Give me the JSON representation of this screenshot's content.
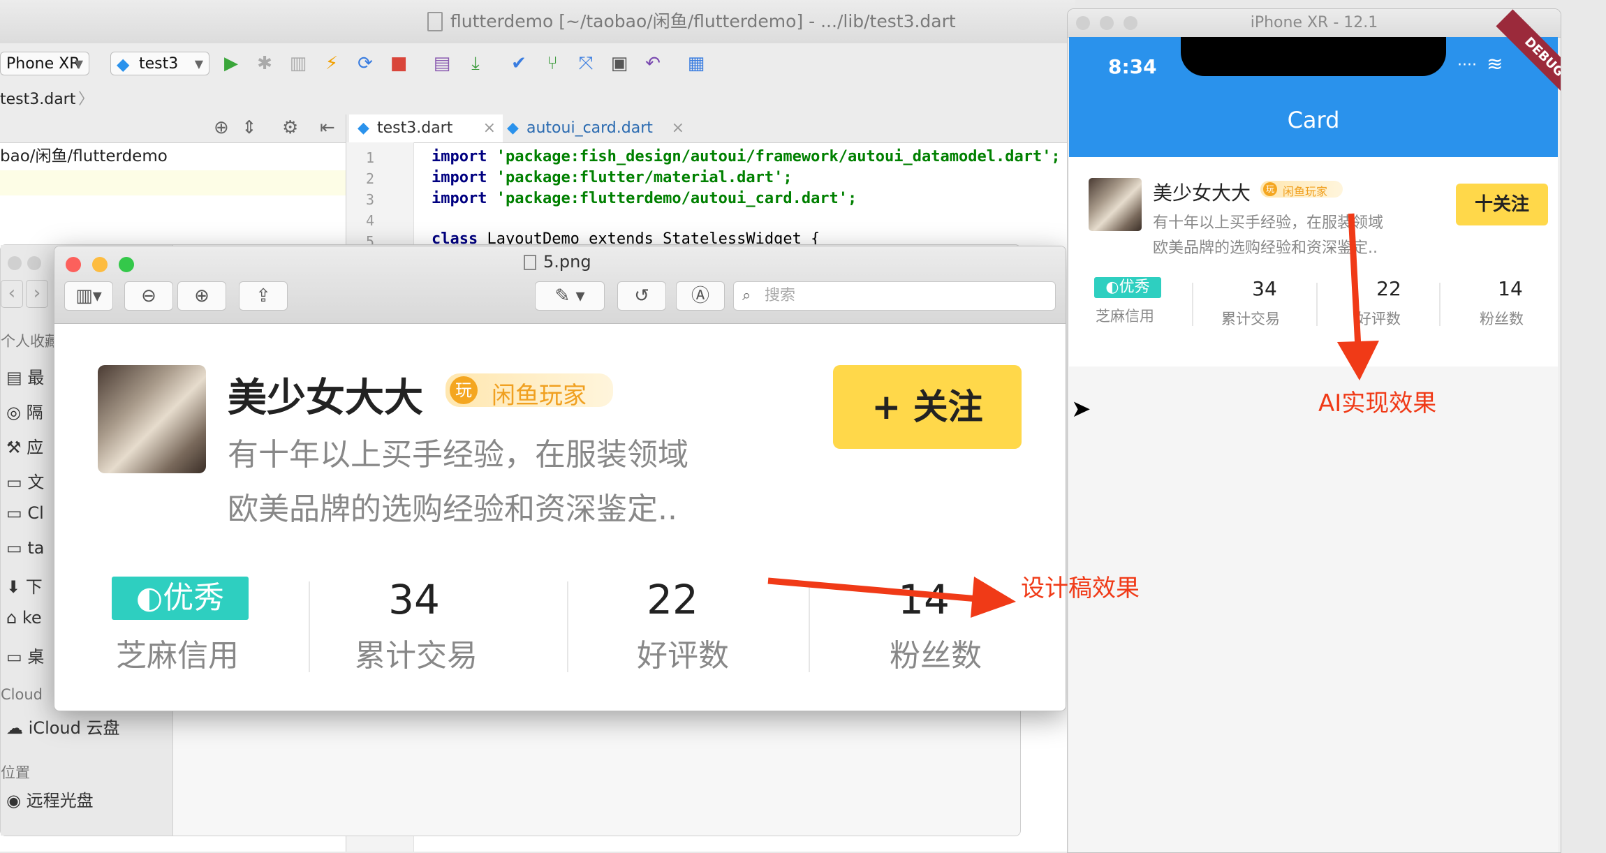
{
  "ide": {
    "window_title": "flutterdemo [~/taobao/闲鱼/flutterdemo] - .../lib/test3.dart [flutterdemo]",
    "device_select": "Phone XR",
    "config_select": "test3",
    "breadcrumb": "test3.dart",
    "project_path": "bao/闲鱼/flutterdemo",
    "tabs": [
      {
        "label": "test3.dart"
      },
      {
        "label": "autoui_card.dart"
      }
    ],
    "code_lines": [
      {
        "num": "1",
        "kw": "import",
        "rest": " 'package:fish_design/autoui/framework/autoui_datamodel.dart';"
      },
      {
        "num": "2",
        "kw": "import",
        "rest": " 'package:flutter/material.dart';"
      },
      {
        "num": "3",
        "kw": "import",
        "rest": " 'package:flutterdemo/autoui_card.dart';"
      },
      {
        "num": "4",
        "kw": "",
        "rest": ""
      },
      {
        "num": "5",
        "kw": "class",
        "rest": " LayoutDemo extends StatelessWidget {"
      }
    ]
  },
  "finder": {
    "sidebar_items": [
      "个人收藏",
      "最",
      "隔",
      "应",
      "文",
      "Cl",
      "ta",
      "下",
      "ke",
      "桌"
    ],
    "cloud_heading": "Cloud",
    "icloud_item": "iCloud 云盘",
    "location_heading": "位置",
    "remote_disc": "远程光盘"
  },
  "preview": {
    "title": "5.png",
    "search_placeholder": "搜索",
    "card": {
      "name": "美少女大大",
      "badge": "闲鱼玩家",
      "badge_icon": "玩",
      "description_line1": "有十年以上买手经验，在服装领域",
      "description_line2": "欧美品牌的选购经验和资深鉴定..",
      "follow_label": "+ 关注",
      "credit_badge": "优秀",
      "credit_label": "芝麻信用",
      "stats": [
        {
          "value": "34",
          "label": "累计交易"
        },
        {
          "value": "22",
          "label": "好评数"
        },
        {
          "value": "14",
          "label": "粉丝数"
        }
      ]
    }
  },
  "simulator": {
    "window_title": "iPhone XR - 12.1",
    "time": "8:34",
    "debug_ribbon": "DEBUG",
    "appbar_title": "Card",
    "card": {
      "name": "美少女大大",
      "badge": "闲鱼玩家",
      "badge_icon": "玩",
      "description_line1": "有十年以上买手经验，在服装领域",
      "description_line2": "欧美品牌的选购经验和资深鉴定..",
      "follow_label": "十关注",
      "credit_badge": "优秀",
      "credit_label": "芝麻信用",
      "stats": [
        {
          "value": "34",
          "label": "累计交易"
        },
        {
          "value": "22",
          "label": "好评数"
        },
        {
          "value": "14",
          "label": "粉丝数"
        }
      ]
    }
  },
  "annotations": {
    "ai_label": "AI实现效果",
    "design_label": "设计稿效果",
    "color": "#f03a17"
  },
  "colors": {
    "appbar": "#2a92ec",
    "follow_button": "#ffd84a",
    "credit_badge": "#2ecfc0"
  }
}
